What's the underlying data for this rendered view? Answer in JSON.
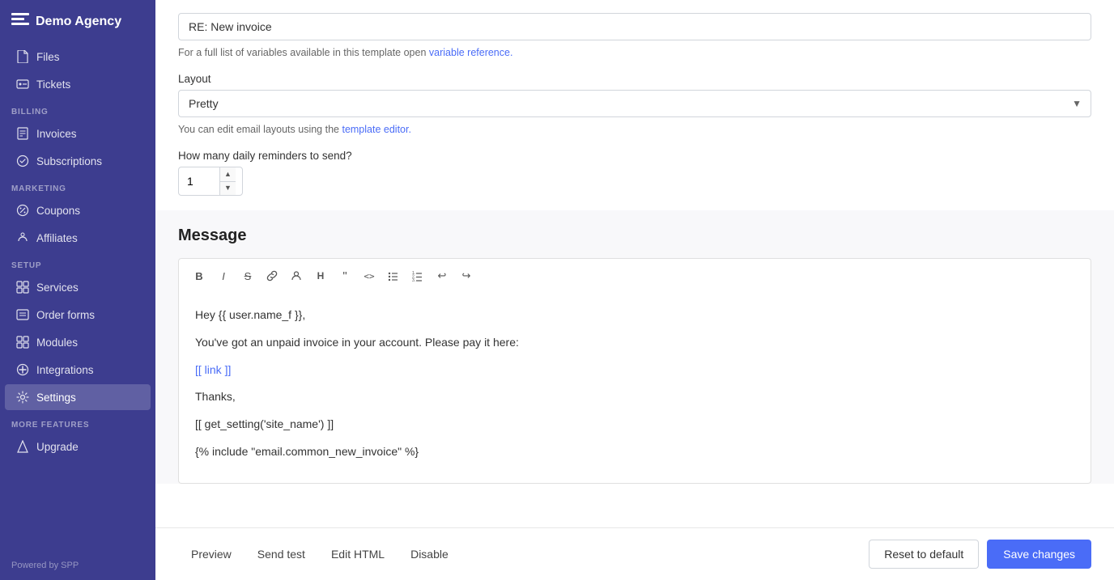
{
  "app": {
    "name": "Demo Agency",
    "powered_by": "Powered by SPP"
  },
  "sidebar": {
    "items": [
      {
        "id": "files",
        "label": "Files",
        "icon": "file-icon",
        "section": null,
        "active": false
      },
      {
        "id": "tickets",
        "label": "Tickets",
        "icon": "ticket-icon",
        "section": null,
        "active": false
      },
      {
        "id": "invoices",
        "label": "Invoices",
        "icon": "invoice-icon",
        "section": "BILLING",
        "active": false
      },
      {
        "id": "subscriptions",
        "label": "Subscriptions",
        "icon": "subscriptions-icon",
        "section": null,
        "active": false
      },
      {
        "id": "coupons",
        "label": "Coupons",
        "icon": "coupons-icon",
        "section": "MARKETING",
        "active": false
      },
      {
        "id": "affiliates",
        "label": "Affiliates",
        "icon": "affiliates-icon",
        "section": null,
        "active": false
      },
      {
        "id": "services",
        "label": "Services",
        "icon": "services-icon",
        "section": "SETUP",
        "active": false
      },
      {
        "id": "order-forms",
        "label": "Order forms",
        "icon": "order-forms-icon",
        "section": null,
        "active": false
      },
      {
        "id": "modules",
        "label": "Modules",
        "icon": "modules-icon",
        "section": null,
        "active": false
      },
      {
        "id": "integrations",
        "label": "Integrations",
        "icon": "integrations-icon",
        "section": null,
        "active": false
      },
      {
        "id": "settings",
        "label": "Settings",
        "icon": "settings-icon",
        "section": null,
        "active": true
      },
      {
        "id": "upgrade",
        "label": "Upgrade",
        "icon": "upgrade-icon",
        "section": "MORE FEATURES",
        "active": false
      }
    ]
  },
  "form": {
    "subject_label": "RE: New invoice",
    "variable_hint": "For a full list of variables available in this template open",
    "variable_link_text": "variable reference.",
    "layout_label": "Layout",
    "layout_value": "Pretty",
    "layout_hint_prefix": "You can edit email layouts using the",
    "layout_hint_link": "template editor.",
    "reminders_label": "How many daily reminders to send?",
    "reminders_value": "1"
  },
  "editor": {
    "section_title": "Message",
    "toolbar": {
      "bold": "B",
      "italic": "I",
      "strikethrough": "S",
      "link": "🔗",
      "person": "👤",
      "heading": "H",
      "quote": "❝",
      "code": "<>",
      "bullet": "•",
      "ordered": "1.",
      "undo": "↩",
      "redo": "↪"
    },
    "content": {
      "line1": "Hey {{ user.name_f }},",
      "line2": "You've got an unpaid invoice in your account. Please pay it here:",
      "link_text": "[[ link ]]",
      "line3": "Thanks,",
      "line4": "[[ get_setting('site_name') ]]",
      "line5": "{% include \"email.common_new_invoice\" %}"
    }
  },
  "bottom_bar": {
    "tabs": [
      {
        "id": "preview",
        "label": "Preview"
      },
      {
        "id": "send-test",
        "label": "Send test"
      },
      {
        "id": "edit-html",
        "label": "Edit HTML"
      },
      {
        "id": "disable",
        "label": "Disable"
      }
    ],
    "reset_label": "Reset to default",
    "save_label": "Save changes"
  }
}
